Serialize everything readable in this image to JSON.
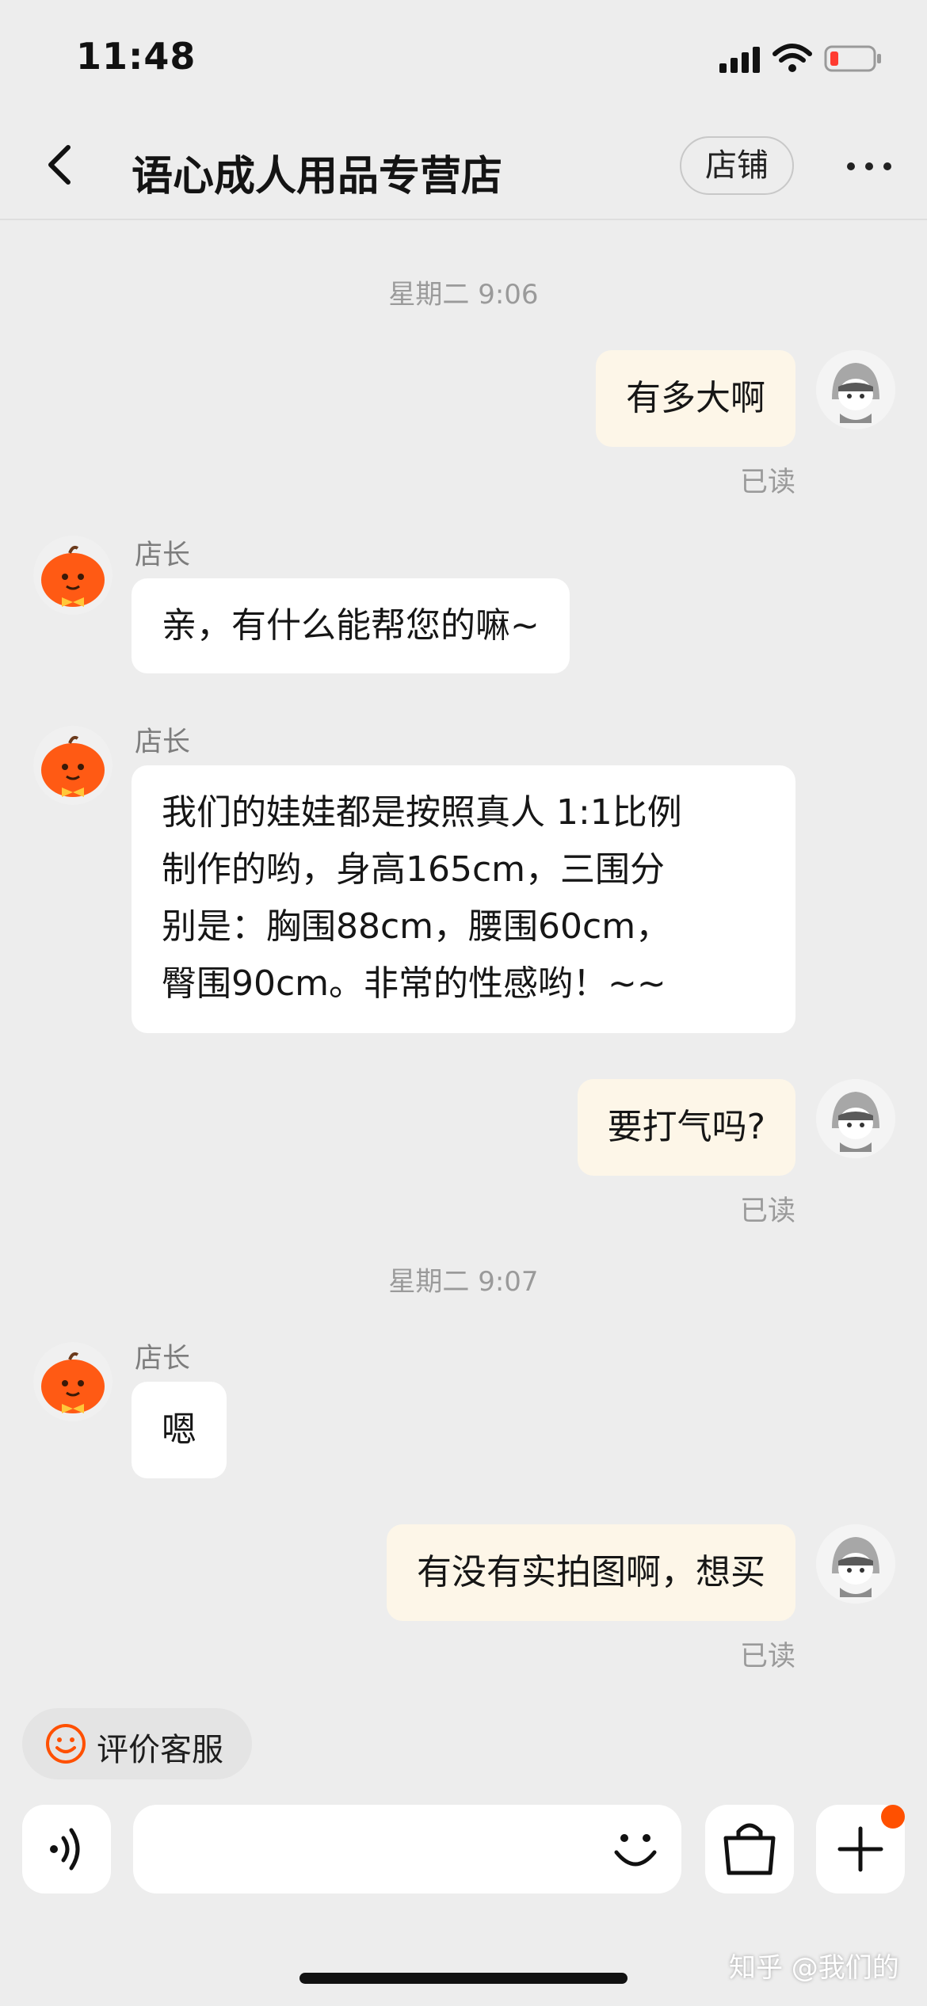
{
  "status_bar": {
    "time": "11:48"
  },
  "header": {
    "title": "语心成人用品专营店",
    "shop_button": "店铺"
  },
  "messages": [
    {
      "type": "timestamp",
      "text": "星期二 9:06"
    },
    {
      "type": "out",
      "text": "有多大啊",
      "status": "已读"
    },
    {
      "type": "in",
      "sender": "店长",
      "text": "亲，有什么能帮您的嘛~"
    },
    {
      "type": "in",
      "sender": "店长",
      "lines": [
        "我们的娃娃都是按照真人 1:1比例",
        "制作的哟，身高165cm，三围分",
        "别是：胸围88cm，腰围60cm，",
        "臀围90cm。非常的性感哟！~~"
      ]
    },
    {
      "type": "out",
      "text": "要打气吗?",
      "status": "已读"
    },
    {
      "type": "timestamp",
      "text": "星期二 9:07"
    },
    {
      "type": "in",
      "sender": "店长",
      "text": "嗯"
    },
    {
      "type": "out",
      "text": "有没有实拍图啊，想买",
      "status": "已读"
    }
  ],
  "quick_actions": {
    "rate_service": "评价客服"
  },
  "input": {
    "placeholder": ""
  },
  "watermark": "知乎 @我们的",
  "colors": {
    "accent": "#ff5000",
    "out_bubble": "#fdf6e8",
    "background": "#ededed"
  }
}
